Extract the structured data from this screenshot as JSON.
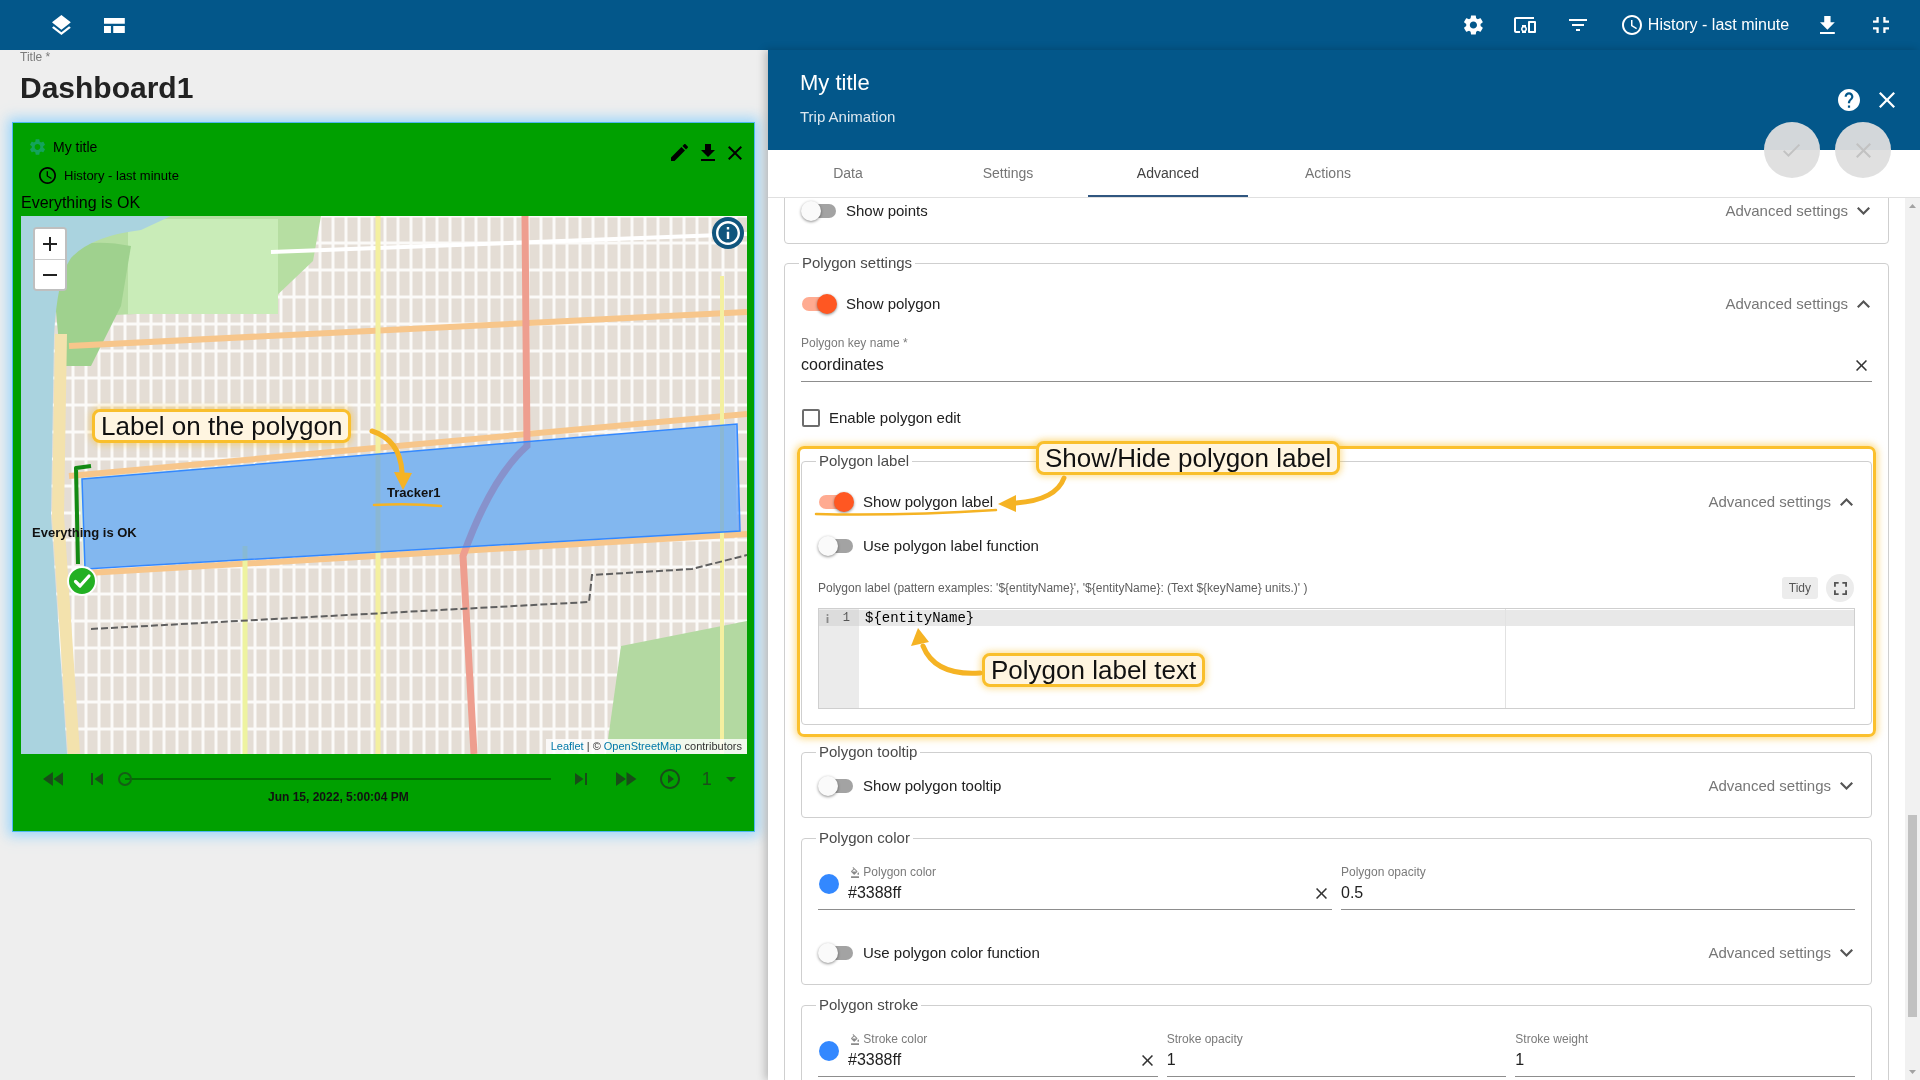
{
  "top_bar": {
    "history": "History - last minute"
  },
  "dashboard": {
    "title_label": "Title *",
    "title": "Dashboard1",
    "widget": {
      "title": "My title",
      "timewindow": "History - last minute",
      "status": "Everything is OK",
      "map": {
        "polygon_label": "Tracker1",
        "marker_label": "Everything is OK",
        "attribution": [
          {
            "kind": "link",
            "text": "Leaflet"
          },
          {
            "kind": "text",
            "text": " | © "
          },
          {
            "kind": "link",
            "text": "OpenStreetMap"
          },
          {
            "kind": "text",
            "text": " contributors"
          }
        ]
      },
      "player": {
        "level": 0,
        "timestamp": "Jun 15, 2022, 5:00:04 PM",
        "speed": "1"
      }
    }
  },
  "panel": {
    "title": "My title",
    "subtitle": "Trip Animation",
    "actions": [
      {
        "kind": "apply",
        "disabled": true
      },
      {
        "kind": "cancel",
        "disabled": true
      }
    ],
    "tabs": [
      {
        "label": "Data",
        "selected": false
      },
      {
        "label": "Settings",
        "selected": false
      },
      {
        "label": "Advanced",
        "selected": true
      },
      {
        "label": "Actions",
        "selected": false
      }
    ],
    "groups": [
      {
        "items": [
          {
            "kind": "toggle",
            "label": "Show points",
            "on": false,
            "advanced": "Advanced settings",
            "expanded": false
          }
        ]
      },
      {
        "legend": "Polygon settings",
        "items": [
          {
            "kind": "toggle",
            "label": "Show polygon",
            "on": true,
            "advanced": "Advanced settings",
            "expanded": true
          },
          {
            "kind": "field",
            "label": "Polygon key name *",
            "value": "coordinates",
            "clearable": true
          },
          {
            "kind": "checkbox",
            "label": "Enable polygon edit",
            "checked": false
          },
          {
            "kind": "group",
            "legend": "Polygon label",
            "highlighted": true,
            "items": [
              {
                "kind": "toggle",
                "label": "Show polygon label",
                "on": true,
                "advanced": "Advanced settings",
                "expanded": true
              },
              {
                "kind": "toggle",
                "label": "Use polygon label function",
                "on": false
              },
              {
                "kind": "editor",
                "label": "Polygon label (pattern examples: '${entityName}', '${entityName}: (Text ${keyName} units.)' )",
                "tidy": "Tidy",
                "lines": [
                  {
                    "number": "1",
                    "text": "${entityName}",
                    "kind": "info"
                  }
                ]
              }
            ]
          },
          {
            "kind": "group",
            "legend": "Polygon tooltip",
            "highlighted": false,
            "items": [
              {
                "kind": "toggle",
                "label": "Show polygon tooltip",
                "on": false,
                "advanced": "Advanced settings",
                "expanded": false
              }
            ]
          },
          {
            "kind": "group",
            "legend": "Polygon color",
            "highlighted": false,
            "items": [
              {
                "kind": "fields",
                "fields": [
                  {
                    "kind": "color",
                    "label": "Polygon color",
                    "value": "#3388ff",
                    "color": "#3388ff",
                    "clearable": true
                  },
                  {
                    "kind": "text",
                    "label": "Polygon opacity",
                    "value": "0.5",
                    "clearable": false
                  }
                ]
              },
              {
                "kind": "toggle",
                "label": "Use polygon color function",
                "on": false,
                "advanced": "Advanced settings",
                "expanded": false
              }
            ]
          },
          {
            "kind": "group",
            "legend": "Polygon stroke",
            "highlighted": false,
            "items": [
              {
                "kind": "fields",
                "fields": [
                  {
                    "kind": "color",
                    "label": "Stroke color",
                    "value": "#3388ff",
                    "color": "#3388ff",
                    "clearable": true
                  },
                  {
                    "kind": "text",
                    "label": "Stroke opacity",
                    "value": "1",
                    "clearable": false
                  },
                  {
                    "kind": "text",
                    "label": "Stroke weight",
                    "value": "1",
                    "clearable": false
                  }
                ]
              }
            ]
          }
        ]
      }
    ]
  },
  "annotations": [
    {
      "text": "Label on the polygon"
    },
    {
      "text": "Show/Hide polygon label"
    },
    {
      "text": "Polygon label text"
    }
  ]
}
